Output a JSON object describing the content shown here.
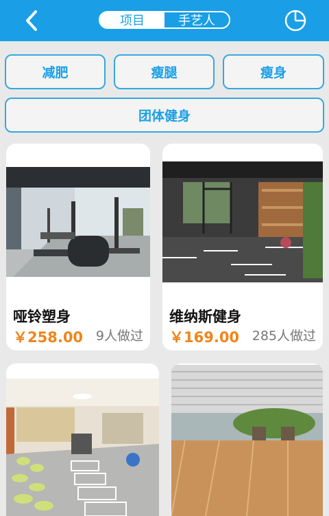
{
  "header": {
    "tabs": [
      {
        "label": "项目",
        "active": true
      },
      {
        "label": "手艺人",
        "active": false
      }
    ],
    "back_icon": "chevron-left-icon",
    "pie_icon": "pie-chart-icon",
    "color": "#1a9fe6"
  },
  "categories": [
    "减肥",
    "瘦腿",
    "瘦身",
    "团体健身"
  ],
  "items": [
    {
      "title": "哑铃塑身",
      "price": "￥258.00",
      "count": "9人做过"
    },
    {
      "title": "维纳斯健身",
      "price": "￥169.00",
      "count": "285人做过"
    }
  ],
  "colors": {
    "accent": "#1a9fe6",
    "price": "#f0851a",
    "background": "#e9e9e9"
  }
}
